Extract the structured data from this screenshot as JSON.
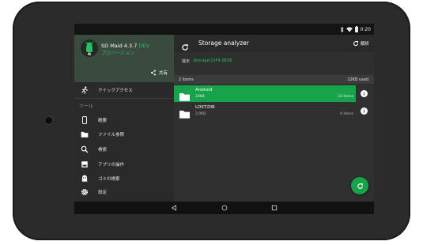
{
  "status_bar": {
    "time": "0:20",
    "icons": [
      "bluetooth-icon",
      "wifi-icon",
      "battery-icon"
    ]
  },
  "drawer": {
    "app_name": "SD Maid 4.3.7",
    "app_channel": "DEV",
    "app_edition": "プロバージョン",
    "share_label": "共有",
    "quick_access": "クイックアクセス",
    "section_tools": "ツール",
    "items": [
      {
        "label": "概要",
        "icon": "phone-icon"
      },
      {
        "label": "ファイル参照",
        "icon": "folder-icon"
      },
      {
        "label": "検索",
        "icon": "search-icon"
      },
      {
        "label": "アプリの操作",
        "icon": "app-box-icon"
      },
      {
        "label": "ゴミの検索",
        "icon": "ghost-icon"
      },
      {
        "label": "設定",
        "icon": "gear-icon"
      }
    ]
  },
  "toolbar": {
    "title": "Storage analyzer",
    "action_label": "解析"
  },
  "path": {
    "label": "端末",
    "value": "/storage/15F4-9E08"
  },
  "summary": {
    "items": "2 items",
    "used": "22KB used"
  },
  "rows": [
    {
      "name": "Android",
      "size": "20KB",
      "count": "10 items",
      "selected": true
    },
    {
      "name": "LOST.DIR",
      "size": "2.0KB",
      "count": "0 items",
      "selected": false
    }
  ],
  "colors": {
    "accent": "#16a34a",
    "accent_text": "#27c060",
    "background": "#303030",
    "drawer": "#2a2a2a"
  }
}
